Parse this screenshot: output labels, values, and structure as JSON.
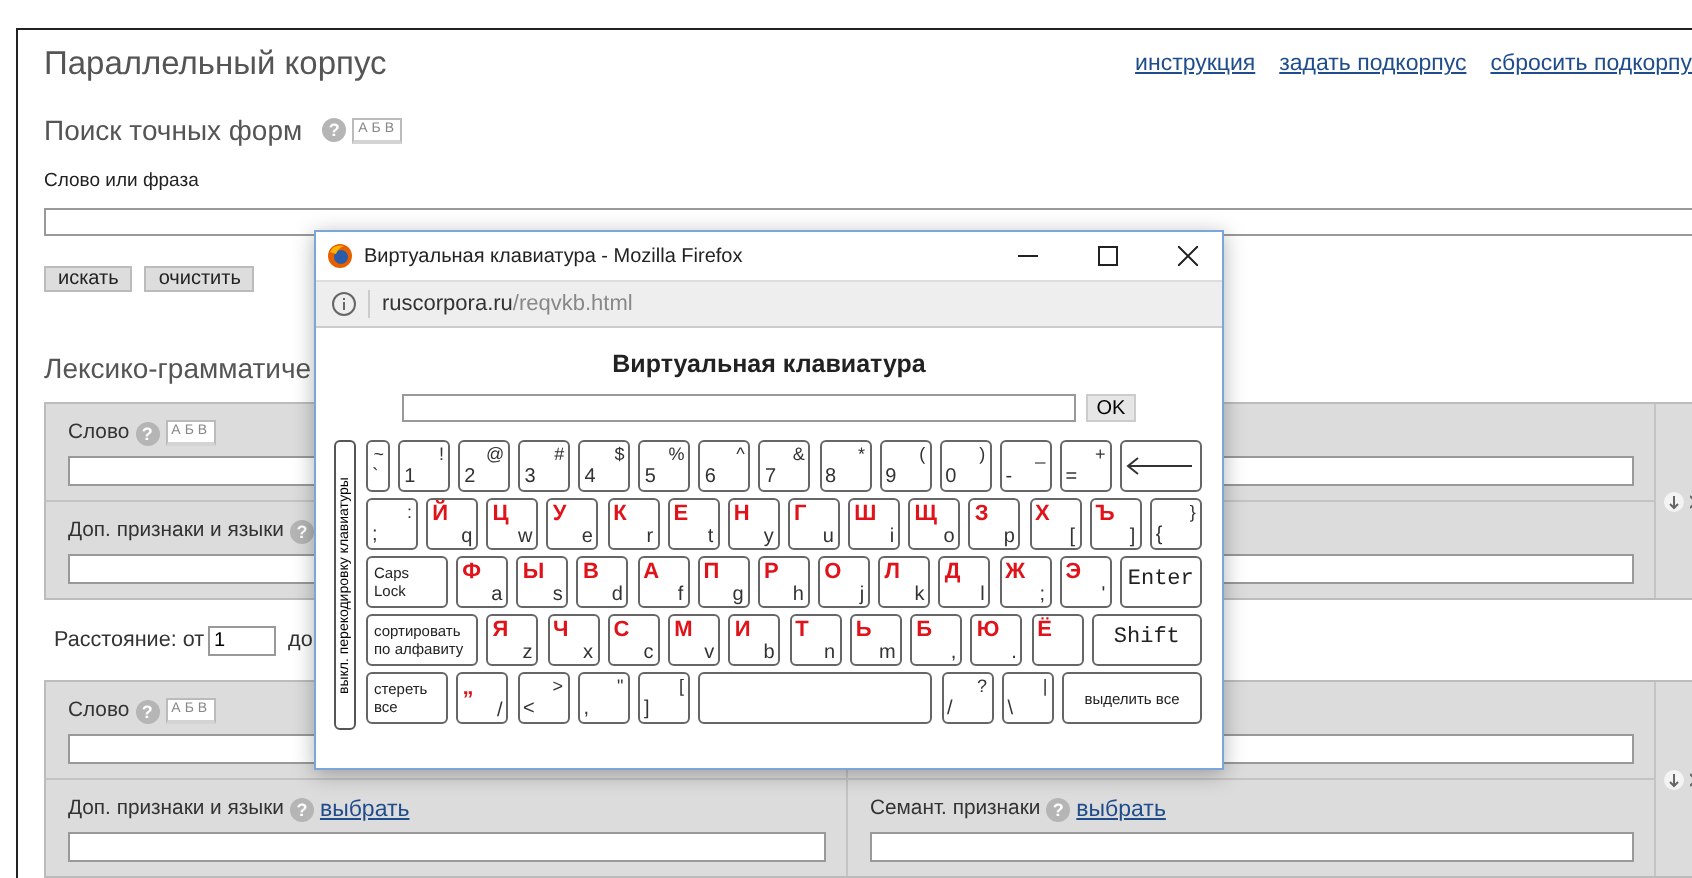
{
  "page": {
    "title": "Параллельный корпус",
    "links": [
      {
        "label": "инструкция"
      },
      {
        "label": "задать подкорпус"
      },
      {
        "label": "сбросить подкорпу"
      }
    ]
  },
  "exact_search": {
    "title": "Поиск точных форм",
    "help": "?",
    "keyboard": "АБВ",
    "field_label": "Слово или фраза",
    "buttons": [
      "искать",
      "очистить"
    ]
  },
  "lexgram": {
    "title": "Лексико-грамматиче",
    "block_1": {
      "rows": [
        {
          "left": {
            "label": "Слово",
            "help": "?",
            "keyboard": "АБВ"
          },
          "right": {}
        },
        {
          "left": {
            "label": "Доп. признаки и языки",
            "help": "?"
          },
          "right": {}
        }
      ]
    },
    "distance": {
      "label": "Расстояние: от",
      "value": "1",
      "to_label": "до"
    },
    "block_2": {
      "rows": [
        {
          "left": {
            "label": "Слово",
            "help": "?",
            "keyboard": "АБВ"
          },
          "right": {}
        },
        {
          "left": {
            "label": "Доп. признаки и языки",
            "help": "?",
            "link": "выбрать"
          },
          "right": {
            "label": "Семант. признаки",
            "help": "?",
            "link": "выбрать"
          }
        }
      ]
    }
  },
  "popup": {
    "title": "Виртуальная клавиатура - Mozilla Firefox",
    "url_host": "ruscorpora.ru",
    "url_path": "/reqvkb.html",
    "heading": "Виртуальная клавиатура",
    "ok": "OK",
    "toggle": "выкл. перекодировку клавиатуры",
    "rows": [
      {
        "keys": [
          {
            "kind": "narrow",
            "main": "`",
            "sub": "~"
          },
          {
            "kind": "symbol",
            "main": "1",
            "sub": "!"
          },
          {
            "kind": "symbol",
            "main": "2",
            "sub": "@"
          },
          {
            "kind": "symbol",
            "main": "3",
            "sub": "#"
          },
          {
            "kind": "symbol",
            "main": "4",
            "sub": "$"
          },
          {
            "kind": "symbol",
            "main": "5",
            "sub": "%"
          },
          {
            "kind": "symbol",
            "main": "6",
            "sub": "^"
          },
          {
            "kind": "symbol",
            "main": "7",
            "sub": "&"
          },
          {
            "kind": "symbol",
            "main": "8",
            "sub": "*"
          },
          {
            "kind": "symbol",
            "main": "9",
            "sub": "("
          },
          {
            "kind": "symbol",
            "main": "0",
            "sub": ")"
          },
          {
            "kind": "symbol",
            "main": "-",
            "sub": "_"
          },
          {
            "kind": "symbol",
            "main": "=",
            "sub": "+"
          },
          {
            "kind": "backspace"
          }
        ]
      },
      {
        "keys": [
          {
            "kind": "symbol",
            "main": ";",
            "sub": ":"
          },
          {
            "kind": "letter",
            "main": "Й",
            "sub": "q"
          },
          {
            "kind": "letter",
            "main": "Ц",
            "sub": "w"
          },
          {
            "kind": "letter",
            "main": "У",
            "sub": "e"
          },
          {
            "kind": "letter",
            "main": "К",
            "sub": "r"
          },
          {
            "kind": "letter",
            "main": "Е",
            "sub": "t"
          },
          {
            "kind": "letter",
            "main": "Н",
            "sub": "y"
          },
          {
            "kind": "letter",
            "main": "Г",
            "sub": "u"
          },
          {
            "kind": "letter",
            "main": "Ш",
            "sub": "i"
          },
          {
            "kind": "letter",
            "main": "Щ",
            "sub": "o"
          },
          {
            "kind": "letter",
            "main": "З",
            "sub": "p"
          },
          {
            "kind": "letter",
            "main": "Х",
            "sub": "["
          },
          {
            "kind": "letter",
            "main": "Ъ",
            "sub": "]"
          },
          {
            "kind": "symbol",
            "main": "{",
            "sub": "}"
          }
        ]
      },
      {
        "keys": [
          {
            "kind": "caps",
            "label": "Caps Lock"
          },
          {
            "kind": "letter",
            "main": "Ф",
            "sub": "a"
          },
          {
            "kind": "letter",
            "main": "Ы",
            "sub": "s"
          },
          {
            "kind": "letter",
            "main": "В",
            "sub": "d"
          },
          {
            "kind": "letter",
            "main": "А",
            "sub": "f"
          },
          {
            "kind": "letter",
            "main": "П",
            "sub": "g"
          },
          {
            "kind": "letter",
            "main": "Р",
            "sub": "h"
          },
          {
            "kind": "letter",
            "main": "О",
            "sub": "j"
          },
          {
            "kind": "letter",
            "main": "Л",
            "sub": "k"
          },
          {
            "kind": "letter",
            "main": "Д",
            "sub": "l"
          },
          {
            "kind": "letter",
            "main": "Ж",
            "sub": ";"
          },
          {
            "kind": "letter",
            "main": "Э",
            "sub": "'"
          },
          {
            "kind": "enter",
            "label": "Enter"
          }
        ]
      },
      {
        "keys": [
          {
            "kind": "sort",
            "label": "сортировать по алфавиту"
          },
          {
            "kind": "letter",
            "main": "Я",
            "sub": "z"
          },
          {
            "kind": "letter",
            "main": "Ч",
            "sub": "x"
          },
          {
            "kind": "letter",
            "main": "С",
            "sub": "c"
          },
          {
            "kind": "letter",
            "main": "М",
            "sub": "v"
          },
          {
            "kind": "letter",
            "main": "И",
            "sub": "b"
          },
          {
            "kind": "letter",
            "main": "Т",
            "sub": "n"
          },
          {
            "kind": "letter",
            "main": "Ь",
            "sub": "m"
          },
          {
            "kind": "letter",
            "main": "Б",
            "sub": ","
          },
          {
            "kind": "letter",
            "main": "Ю",
            "sub": "."
          },
          {
            "kind": "letter",
            "main": "Ё"
          },
          {
            "kind": "shift",
            "label": "Shift"
          }
        ]
      },
      {
        "keys": [
          {
            "kind": "erase",
            "label": "стереть все"
          },
          {
            "kind": "letter",
            "main": "„",
            "sub": "/"
          },
          {
            "kind": "symbol",
            "main": "<",
            "sub": ">"
          },
          {
            "kind": "symbol",
            "main": ",",
            "sub": "\""
          },
          {
            "kind": "symbol",
            "main": "]",
            "sub": "["
          },
          {
            "kind": "space"
          },
          {
            "kind": "symbol",
            "main": "/",
            "sub": "?"
          },
          {
            "kind": "symbol",
            "main": "\\",
            "sub": "|"
          },
          {
            "kind": "select-all",
            "label": "выделить все"
          }
        ]
      }
    ]
  }
}
